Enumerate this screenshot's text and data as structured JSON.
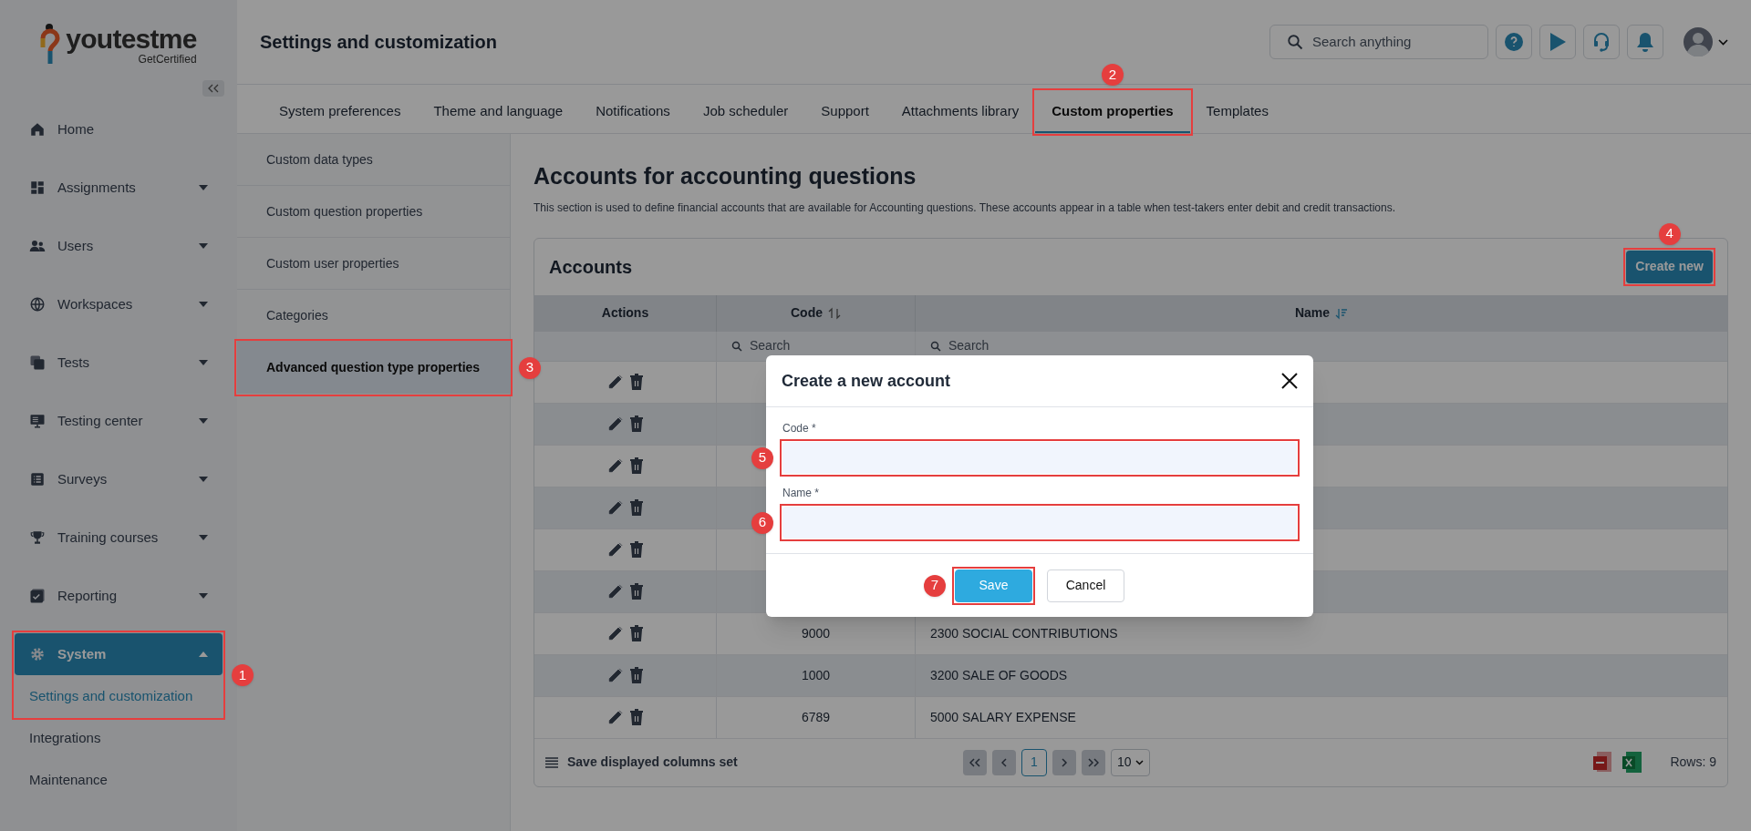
{
  "logo": {
    "name": "youtestme",
    "tagline": "GetCertified"
  },
  "sidebar": {
    "items": [
      {
        "label": "Home",
        "selected": false
      },
      {
        "label": "Assignments",
        "selected": false,
        "expanded": false
      },
      {
        "label": "Users",
        "selected": false,
        "expanded": false
      },
      {
        "label": "Workspaces",
        "selected": false,
        "expanded": false
      },
      {
        "label": "Tests",
        "selected": false,
        "expanded": false
      },
      {
        "label": "Testing center",
        "selected": false,
        "expanded": false
      },
      {
        "label": "Surveys",
        "selected": false,
        "expanded": false
      },
      {
        "label": "Training courses",
        "selected": false,
        "expanded": false
      },
      {
        "label": "Reporting",
        "selected": false,
        "expanded": false
      },
      {
        "label": "System",
        "selected": true,
        "expanded": true,
        "callout": "1",
        "children": [
          {
            "label": "Settings and customization",
            "selected": true
          },
          {
            "label": "Integrations",
            "selected": false
          },
          {
            "label": "Maintenance",
            "selected": false
          }
        ]
      }
    ]
  },
  "header": {
    "title": "Settings and customization",
    "search": {
      "placeholder": "Search anything"
    }
  },
  "tabs": [
    {
      "label": "System preferences",
      "selected": false
    },
    {
      "label": "Theme and language",
      "selected": false
    },
    {
      "label": "Notifications",
      "selected": false
    },
    {
      "label": "Job scheduler",
      "selected": false
    },
    {
      "label": "Support",
      "selected": false
    },
    {
      "label": "Attachments library",
      "selected": false
    },
    {
      "label": "Custom properties",
      "selected": true,
      "callout": "2"
    },
    {
      "label": "Templates",
      "selected": false
    }
  ],
  "submenu": [
    {
      "label": "Custom data types",
      "selected": false
    },
    {
      "label": "Custom question properties",
      "selected": false
    },
    {
      "label": "Custom user properties",
      "selected": false
    },
    {
      "label": "Categories",
      "selected": false
    },
    {
      "label": "Advanced question type properties",
      "selected": true,
      "callout": "3"
    }
  ],
  "page": {
    "title": "Accounts for accounting questions",
    "description": "This section is used to define financial accounts that are available for Accounting questions. These accounts appear in a table when test-takers enter debit and credit transactions."
  },
  "table": {
    "title": "Accounts",
    "create_button": {
      "label": "Create new",
      "callout": "4"
    },
    "columns": [
      {
        "label": "Actions"
      },
      {
        "label": "Code",
        "sortable": true,
        "sort_active": false
      },
      {
        "label": "Name",
        "sortable": true,
        "sort_active": true
      }
    ],
    "filters": [
      {
        "placeholder": "Search"
      },
      {
        "placeholder": "Search"
      }
    ],
    "rows": [
      {},
      {},
      {},
      {},
      {},
      {},
      {
        "code": "9000",
        "name": "2300 SOCIAL CONTRIBUTIONS"
      },
      {
        "code": "1000",
        "name": "3200 SALE OF GOODS"
      },
      {
        "code": "6789",
        "name": "5000 SALARY EXPENSE"
      }
    ],
    "footer": {
      "columns_set": "Save displayed columns set",
      "pages": [
        {
          "label": "1",
          "selected": true
        }
      ],
      "page_size": "10",
      "rows": "Rows: 9"
    }
  },
  "dialog": {
    "title": "Create a new account",
    "fields": [
      {
        "label": "Code *",
        "callout": "5"
      },
      {
        "label": "Name *",
        "callout": "6"
      }
    ],
    "buttons": [
      {
        "label": "Save",
        "kind": "primary",
        "callout": "7"
      },
      {
        "label": "Cancel",
        "kind": "secondary"
      }
    ]
  }
}
